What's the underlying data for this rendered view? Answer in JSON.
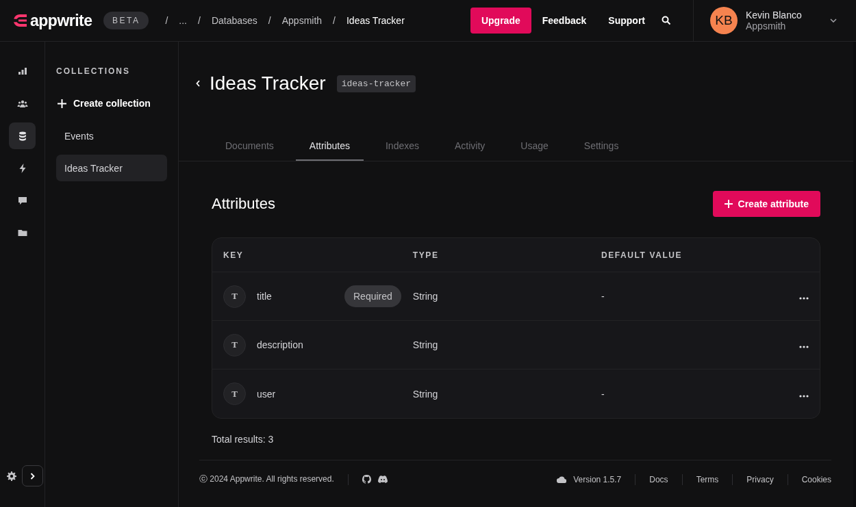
{
  "header": {
    "logo": "appwrite",
    "badge": "BETA",
    "breadcrumbs": [
      {
        "separator": "/",
        "label": "...",
        "current": false
      },
      {
        "separator": "/",
        "label": "Databases",
        "current": false
      },
      {
        "separator": "/",
        "label": "Appsmith",
        "current": false
      },
      {
        "separator": "/",
        "label": "Ideas Tracker",
        "current": true
      }
    ],
    "buttons": [
      {
        "label": "Upgrade",
        "kind": "primary"
      },
      {
        "label": "Feedback",
        "kind": "text"
      },
      {
        "label": "Support",
        "kind": "text"
      }
    ],
    "user": {
      "initials": "KB",
      "name": "Kevin Blanco",
      "org": "Appsmith"
    }
  },
  "nav_rail": [
    {
      "selected": false
    },
    {
      "selected": false
    },
    {
      "selected": true
    },
    {
      "selected": false
    },
    {
      "selected": false
    },
    {
      "selected": false
    }
  ],
  "collections": {
    "heading": "COLLECTIONS",
    "create": "Create collection",
    "items": [
      {
        "label": "Events",
        "selected": false
      },
      {
        "label": "Ideas Tracker",
        "selected": true
      }
    ]
  },
  "page": {
    "title": "Ideas Tracker",
    "id": "ideas-tracker",
    "tabs": [
      {
        "label": "Documents",
        "selected": false
      },
      {
        "label": "Attributes",
        "selected": true
      },
      {
        "label": "Indexes",
        "selected": false
      },
      {
        "label": "Activity",
        "selected": false
      },
      {
        "label": "Usage",
        "selected": false
      },
      {
        "label": "Settings",
        "selected": false
      }
    ],
    "section_title": "Attributes",
    "create_button": "Create attribute",
    "table": {
      "columns": [
        "KEY",
        "TYPE",
        "DEFAULT VALUE"
      ],
      "rows": [
        {
          "type_icon": "T",
          "key": "title",
          "required": true,
          "required_label": "Required",
          "type": "String",
          "default": "-"
        },
        {
          "type_icon": "T",
          "key": "description",
          "required": false,
          "type": "String"
        },
        {
          "type_icon": "T",
          "key": "user",
          "required": false,
          "type": "String",
          "default": "-"
        }
      ]
    },
    "total": "Total results: 3"
  },
  "footer": {
    "copyright": "ⓒ 2024 Appwrite. All rights reserved.",
    "version": "Version 1.5.7",
    "links": [
      "Docs",
      "Terms",
      "Privacy",
      "Cookies"
    ]
  }
}
